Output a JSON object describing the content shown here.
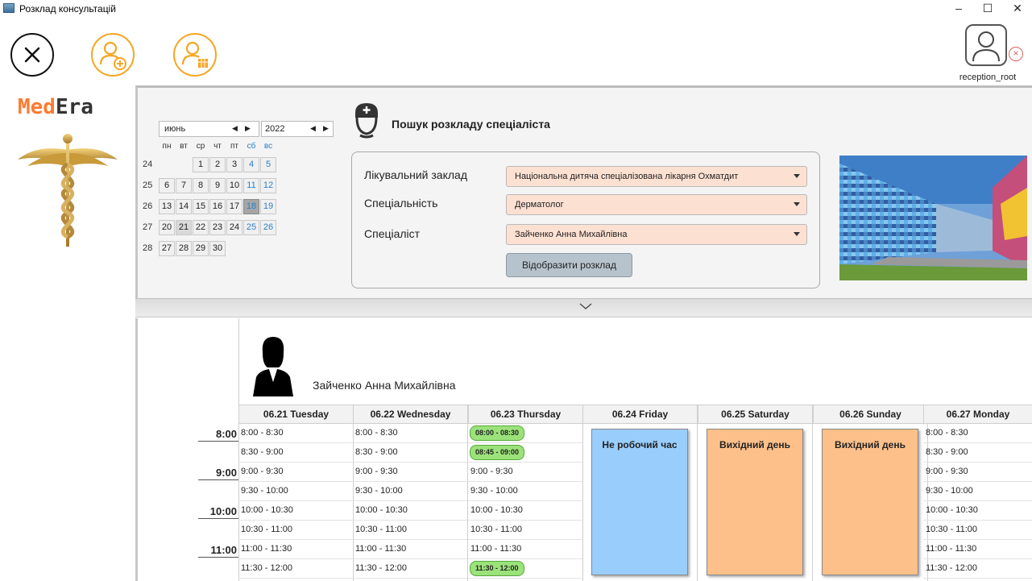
{
  "window": {
    "title": "Розклад консультацій",
    "minimize": "–",
    "maximize": "☐",
    "close": "✕"
  },
  "toolbar": {
    "close_icon": "close-icon",
    "add_patient_icon": "add-patient-icon",
    "schedule_icon": "doctor-schedule-icon",
    "user": {
      "name": "reception_root",
      "logout_glyph": "×"
    },
    "accent_color": "#f5a623"
  },
  "logo": {
    "part1": "Med",
    "part2": "Era"
  },
  "calendar": {
    "month": "июнь",
    "year": "2022",
    "weekdays": [
      "пн",
      "вт",
      "ср",
      "чт",
      "пт",
      "сб",
      "вс"
    ],
    "weeks": [
      {
        "num": "24",
        "days": [
          "",
          "",
          "1",
          "2",
          "3",
          "4",
          "5"
        ]
      },
      {
        "num": "25",
        "days": [
          "6",
          "7",
          "8",
          "9",
          "10",
          "11",
          "12"
        ]
      },
      {
        "num": "26",
        "days": [
          "13",
          "14",
          "15",
          "16",
          "17",
          "18",
          "19"
        ]
      },
      {
        "num": "27",
        "days": [
          "20",
          "21",
          "22",
          "23",
          "24",
          "25",
          "26"
        ]
      },
      {
        "num": "28",
        "days": [
          "27",
          "28",
          "29",
          "30",
          "",
          "",
          ""
        ]
      }
    ],
    "selected": "18",
    "today": "21"
  },
  "search": {
    "title": "Пошук розкладу спеціаліста",
    "fields": [
      {
        "label": "Лікувальний заклад",
        "value": "Національна дитяча спеціалізована лікарня Охматдит"
      },
      {
        "label": "Спеціальність",
        "value": "Дерматолог"
      },
      {
        "label": "Спеціаліст",
        "value": "Зайченко Анна Михайлівна"
      }
    ],
    "button": "Відобразити розклад"
  },
  "schedule": {
    "doctor": "Зайченко Анна Михайлівна",
    "hours": [
      "8:00",
      "9:00",
      "10:00",
      "11:00"
    ],
    "slot_times": [
      "8:00 - 8:30",
      "8:30 - 9:00",
      "9:00 - 9:30",
      "9:30 - 10:00",
      "10:00 - 10:30",
      "10:30 - 11:00",
      "11:00 - 11:30",
      "11:30 - 12:00"
    ],
    "days": [
      {
        "header": "06.21 Tuesday",
        "type": "slots",
        "busy": []
      },
      {
        "header": "06.22 Wednesday",
        "type": "slots",
        "busy": []
      },
      {
        "header": "06.23 Thursday",
        "type": "slots",
        "busy": [
          {
            "index": 0,
            "label": "08:00 - 08:30"
          },
          {
            "index": 1,
            "label": "08:45 - 09:00"
          },
          {
            "index": 7,
            "label": "11:30 - 12:00"
          }
        ]
      },
      {
        "header": "06.24 Friday",
        "type": "block",
        "label": "Не робочий час",
        "color": "#99cdfc"
      },
      {
        "header": "06.25 Saturday",
        "type": "block",
        "label": "Вихідний день",
        "color": "#fdc08a"
      },
      {
        "header": "06.26 Sunday",
        "type": "block",
        "label": "Вихідний день",
        "color": "#fdc08a"
      },
      {
        "header": "06.27 Monday",
        "type": "slots",
        "busy": []
      }
    ],
    "busy_color": "#9be27a"
  }
}
